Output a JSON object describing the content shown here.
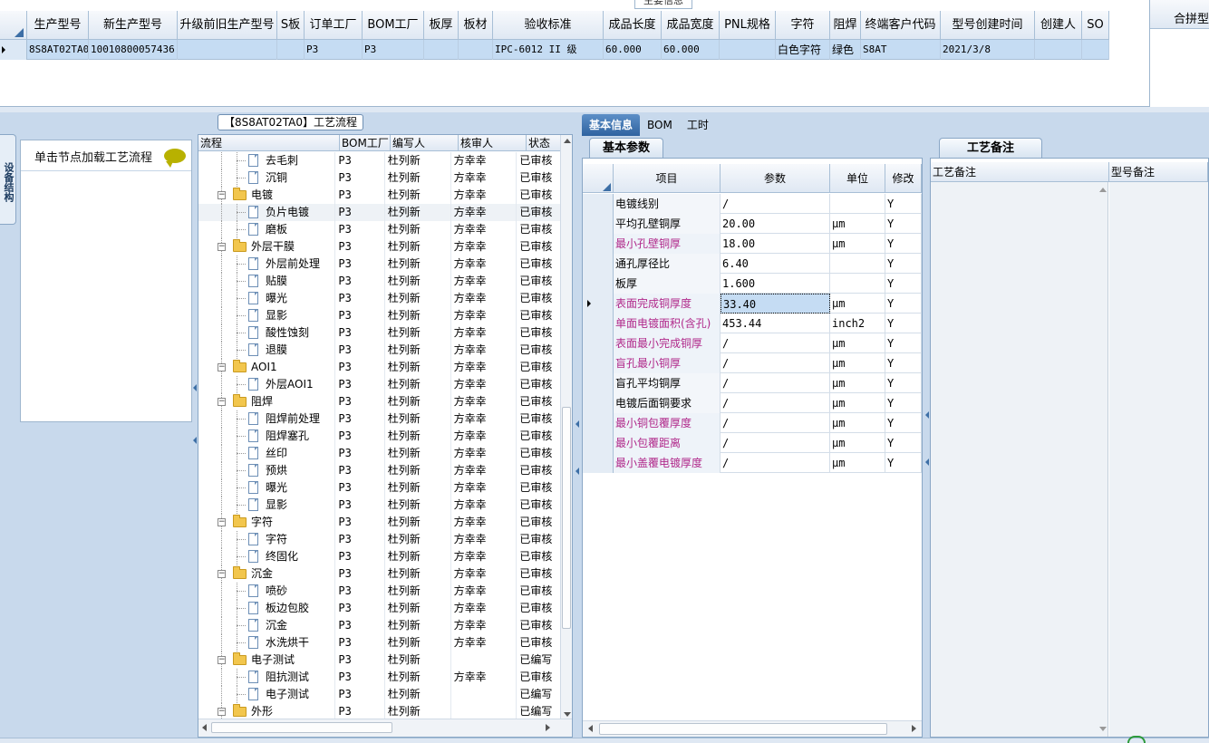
{
  "top_grid": {
    "columns": [
      "生产型号",
      "新生产型号",
      "升级前旧生产型号",
      "S板",
      "订单工厂",
      "BOM工厂",
      "板厚",
      "板材",
      "验收标准",
      "成品长度",
      "成品宽度",
      "PNL规格",
      "字符",
      "阻焊",
      "终端客户代码",
      "型号创建时间",
      "创建人",
      "SO"
    ],
    "row": [
      "8S8AT02TA0",
      "10010800057436",
      "",
      "",
      "P3",
      "P3",
      "",
      "",
      "IPC-6012 II 级",
      "60.000",
      "60.000",
      "",
      "白色字符",
      "绿色",
      "S8AT",
      "2021/3/8",
      "",
      ""
    ]
  },
  "merge_panel": {
    "header": "合拼型号"
  },
  "stub_tab": {
    "label": "主要信息"
  },
  "left": {
    "vertical_tab": "设备结构",
    "node_hint": "单击节点加载工艺流程",
    "flow_title": "【8S8AT02TA0】工艺流程",
    "tree_columns": [
      "流程",
      "BOM工厂",
      "编写人",
      "核审人",
      "状态"
    ],
    "tree_rows": [
      {
        "name": "去毛刺",
        "level": 2,
        "bom": "P3",
        "writer": "杜列新",
        "reviewer": "方幸幸",
        "status": "已审核"
      },
      {
        "name": "沉铜",
        "level": 2,
        "bom": "P3",
        "writer": "杜列新",
        "reviewer": "方幸幸",
        "status": "已审核"
      },
      {
        "name": "电镀",
        "level": 1,
        "bom": "P3",
        "writer": "杜列新",
        "reviewer": "方幸幸",
        "status": "已审核"
      },
      {
        "name": "负片电镀",
        "level": 2,
        "bom": "P3",
        "writer": "杜列新",
        "reviewer": "方幸幸",
        "status": "已审核",
        "selected": true
      },
      {
        "name": "磨板",
        "level": 2,
        "bom": "P3",
        "writer": "杜列新",
        "reviewer": "方幸幸",
        "status": "已审核"
      },
      {
        "name": "外层干膜",
        "level": 1,
        "bom": "P3",
        "writer": "杜列新",
        "reviewer": "方幸幸",
        "status": "已审核"
      },
      {
        "name": "外层前处理",
        "level": 2,
        "bom": "P3",
        "writer": "杜列新",
        "reviewer": "方幸幸",
        "status": "已审核"
      },
      {
        "name": "贴膜",
        "level": 2,
        "bom": "P3",
        "writer": "杜列新",
        "reviewer": "方幸幸",
        "status": "已审核"
      },
      {
        "name": "曝光",
        "level": 2,
        "bom": "P3",
        "writer": "杜列新",
        "reviewer": "方幸幸",
        "status": "已审核"
      },
      {
        "name": "显影",
        "level": 2,
        "bom": "P3",
        "writer": "杜列新",
        "reviewer": "方幸幸",
        "status": "已审核"
      },
      {
        "name": "酸性蚀刻",
        "level": 2,
        "bom": "P3",
        "writer": "杜列新",
        "reviewer": "方幸幸",
        "status": "已审核"
      },
      {
        "name": "退膜",
        "level": 2,
        "bom": "P3",
        "writer": "杜列新",
        "reviewer": "方幸幸",
        "status": "已审核"
      },
      {
        "name": "AOI1",
        "level": 1,
        "bom": "P3",
        "writer": "杜列新",
        "reviewer": "方幸幸",
        "status": "已审核"
      },
      {
        "name": "外层AOI1",
        "level": 2,
        "bom": "P3",
        "writer": "杜列新",
        "reviewer": "方幸幸",
        "status": "已审核"
      },
      {
        "name": "阻焊",
        "level": 1,
        "bom": "P3",
        "writer": "杜列新",
        "reviewer": "方幸幸",
        "status": "已审核"
      },
      {
        "name": "阻焊前处理",
        "level": 2,
        "bom": "P3",
        "writer": "杜列新",
        "reviewer": "方幸幸",
        "status": "已审核"
      },
      {
        "name": "阻焊塞孔",
        "level": 2,
        "bom": "P3",
        "writer": "杜列新",
        "reviewer": "方幸幸",
        "status": "已审核"
      },
      {
        "name": "丝印",
        "level": 2,
        "bom": "P3",
        "writer": "杜列新",
        "reviewer": "方幸幸",
        "status": "已审核"
      },
      {
        "name": "预烘",
        "level": 2,
        "bom": "P3",
        "writer": "杜列新",
        "reviewer": "方幸幸",
        "status": "已审核"
      },
      {
        "name": "曝光",
        "level": 2,
        "bom": "P3",
        "writer": "杜列新",
        "reviewer": "方幸幸",
        "status": "已审核"
      },
      {
        "name": "显影",
        "level": 2,
        "bom": "P3",
        "writer": "杜列新",
        "reviewer": "方幸幸",
        "status": "已审核"
      },
      {
        "name": "字符",
        "level": 1,
        "bom": "P3",
        "writer": "杜列新",
        "reviewer": "方幸幸",
        "status": "已审核"
      },
      {
        "name": "字符",
        "level": 2,
        "bom": "P3",
        "writer": "杜列新",
        "reviewer": "方幸幸",
        "status": "已审核"
      },
      {
        "name": "终固化",
        "level": 2,
        "bom": "P3",
        "writer": "杜列新",
        "reviewer": "方幸幸",
        "status": "已审核"
      },
      {
        "name": "沉金",
        "level": 1,
        "bom": "P3",
        "writer": "杜列新",
        "reviewer": "方幸幸",
        "status": "已审核"
      },
      {
        "name": "喷砂",
        "level": 2,
        "bom": "P3",
        "writer": "杜列新",
        "reviewer": "方幸幸",
        "status": "已审核"
      },
      {
        "name": "板边包胶",
        "level": 2,
        "bom": "P3",
        "writer": "杜列新",
        "reviewer": "方幸幸",
        "status": "已审核"
      },
      {
        "name": "沉金",
        "level": 2,
        "bom": "P3",
        "writer": "杜列新",
        "reviewer": "方幸幸",
        "status": "已审核"
      },
      {
        "name": "水洗烘干",
        "level": 2,
        "bom": "P3",
        "writer": "杜列新",
        "reviewer": "方幸幸",
        "status": "已审核"
      },
      {
        "name": "电子测试",
        "level": 1,
        "bom": "P3",
        "writer": "杜列新",
        "reviewer": "",
        "status": "已编写"
      },
      {
        "name": "阻抗测试",
        "level": 2,
        "bom": "P3",
        "writer": "杜列新",
        "reviewer": "方幸幸",
        "status": "已审核"
      },
      {
        "name": "电子测试",
        "level": 2,
        "bom": "P3",
        "writer": "杜列新",
        "reviewer": "",
        "status": "已编写"
      },
      {
        "name": "外形",
        "level": 1,
        "bom": "P3",
        "writer": "杜列新",
        "reviewer": "",
        "status": "已编写"
      }
    ]
  },
  "right": {
    "tabs": [
      "基本信息",
      "BOM",
      "工时"
    ],
    "basic_params": {
      "subtab": "基本参数",
      "columns": [
        "项目",
        "参数",
        "单位",
        "修改"
      ],
      "rows": [
        {
          "item": "电镀线别",
          "value": "/",
          "unit": "",
          "mod": "Y",
          "pink": false
        },
        {
          "item": "平均孔壁铜厚",
          "value": "20.00",
          "unit": "μm",
          "mod": "Y",
          "pink": false
        },
        {
          "item": "最小孔壁铜厚",
          "value": "18.00",
          "unit": "μm",
          "mod": "Y",
          "pink": true
        },
        {
          "item": "通孔厚径比",
          "value": "6.40",
          "unit": "",
          "mod": "Y",
          "pink": false
        },
        {
          "item": "板厚",
          "value": "1.600",
          "unit": "",
          "mod": "Y",
          "pink": false
        },
        {
          "item": "表面完成铜厚度",
          "value": "33.40",
          "unit": "μm",
          "mod": "Y",
          "pink": true,
          "current": true
        },
        {
          "item": "单面电镀面积(含孔)",
          "value": "453.44",
          "unit": "inch2",
          "mod": "Y",
          "pink": true
        },
        {
          "item": "表面最小完成铜厚",
          "value": "/",
          "unit": "μm",
          "mod": "Y",
          "pink": true
        },
        {
          "item": "盲孔最小铜厚",
          "value": "/",
          "unit": "μm",
          "mod": "Y",
          "pink": true
        },
        {
          "item": "盲孔平均铜厚",
          "value": "/",
          "unit": "μm",
          "mod": "Y",
          "pink": false
        },
        {
          "item": "电镀后面铜要求",
          "value": "/",
          "unit": "μm",
          "mod": "Y",
          "pink": false
        },
        {
          "item": "最小铜包覆厚度",
          "value": "/",
          "unit": "μm",
          "mod": "Y",
          "pink": true
        },
        {
          "item": "最小包覆距离",
          "value": "/",
          "unit": "μm",
          "mod": "Y",
          "pink": true
        },
        {
          "item": "最小盖覆电镀厚度",
          "value": "/",
          "unit": "μm",
          "mod": "Y",
          "pink": true
        }
      ]
    },
    "process_notes": {
      "subtab": "工艺备注",
      "col_left": "工艺备注",
      "col_right": "型号备注"
    }
  },
  "colors": {
    "accent": "#2f63a0",
    "selected_row": "#c5dcf3",
    "pink_label": "#b0288a",
    "panel_bg": "#c8d9ec"
  }
}
